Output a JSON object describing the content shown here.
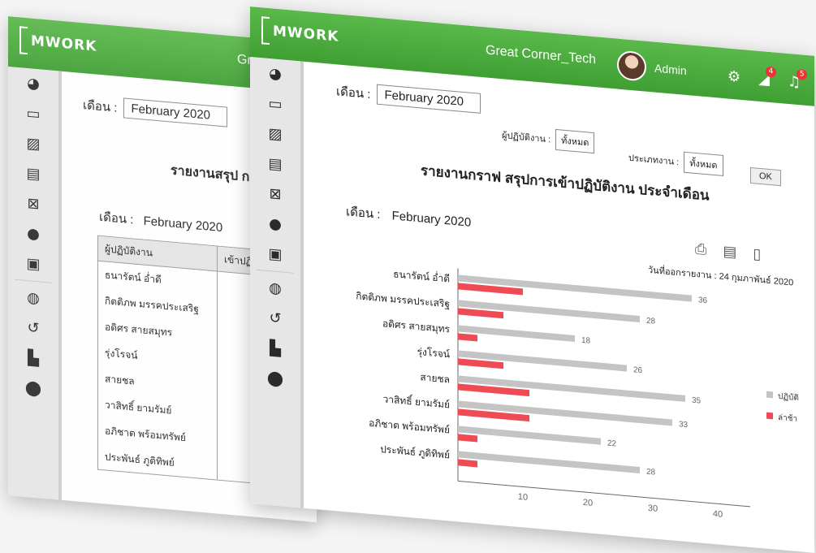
{
  "app": {
    "logo": "MWORK",
    "company": "Great Corner_Tech",
    "company_back": "Gr",
    "user": "Admin",
    "notifications": [
      {
        "icon": "megaphone-icon",
        "count": "4"
      },
      {
        "icon": "bell-icon",
        "count": "5"
      }
    ],
    "accent_color": "#4aae3b"
  },
  "sidebar": {
    "items": [
      {
        "icon": "pie-chart-icon",
        "glyph": "◕"
      },
      {
        "icon": "monitor-icon",
        "glyph": "▭"
      },
      {
        "icon": "image-icon",
        "glyph": "▨"
      },
      {
        "icon": "calendar-icon",
        "glyph": "▤"
      },
      {
        "icon": "calendar-x-icon",
        "glyph": "⊠"
      },
      {
        "icon": "alert-icon",
        "glyph": "●"
      },
      {
        "icon": "id-card-icon",
        "glyph": "▣"
      },
      {
        "icon": "globe-icon",
        "glyph": "◍"
      },
      {
        "icon": "history-icon",
        "glyph": "↺"
      },
      {
        "icon": "building-icon",
        "glyph": "▙"
      },
      {
        "icon": "location-pin-icon",
        "glyph": "⬤"
      }
    ]
  },
  "filters": {
    "month_label": "เดือน :",
    "month_value": "February 2020",
    "worker_label": "ผู้ปฏิบัติงาน :",
    "worker_value": "ทั้งหมด",
    "type_label": "ประเภทงาน :",
    "type_value": "ทั้งหมด",
    "ok_label": "OK"
  },
  "report": {
    "title": "รายงานกราฟ สรุปการเข้าปฏิบัติงาน ประจำเดือน",
    "title_back": "รายงานสรุป ก",
    "month_label": "เดือน :",
    "month_value": "February 2020",
    "issue_date": "วันที่ออกรายงาน : 24 กุมภาพันธ์ 2020",
    "export_icons": [
      "printer-icon",
      "excel-icon",
      "pdf-icon"
    ]
  },
  "back_table": {
    "col_name": "ผู้ปฏิบัติงาน",
    "col_work": "เข้าปฏิบัติ"
  },
  "chart_data": {
    "type": "bar",
    "orientation": "horizontal",
    "categories": [
      "ธนารัตน์ อ่ำดี",
      "กิตติภพ มรรคประเสริฐ",
      "อดิศร สายสมุทร",
      "รุ่งโรจน์",
      "สายชล",
      "วาสิทธิ์ ยามรัมย์",
      "อภิชาต พร้อมทรัพย์",
      "ประพันธ์ ภูดิทิพย์"
    ],
    "series": [
      {
        "name": "ปฏิบัติงาน",
        "values": [
          36,
          28,
          18,
          26,
          35,
          33,
          22,
          28
        ],
        "color": "#c4c4c4",
        "labels": [
          "36",
          "28",
          "18",
          "26",
          "35",
          "33",
          "22",
          "28"
        ]
      },
      {
        "name": "ล่าช้า",
        "values": [
          10,
          7,
          3,
          7,
          11,
          11,
          3,
          3
        ],
        "color": "#ef4b55"
      }
    ],
    "xlim": [
      0,
      40
    ],
    "xticks": [
      "10",
      "20",
      "30",
      "40"
    ],
    "legend": "right",
    "grid": false
  }
}
